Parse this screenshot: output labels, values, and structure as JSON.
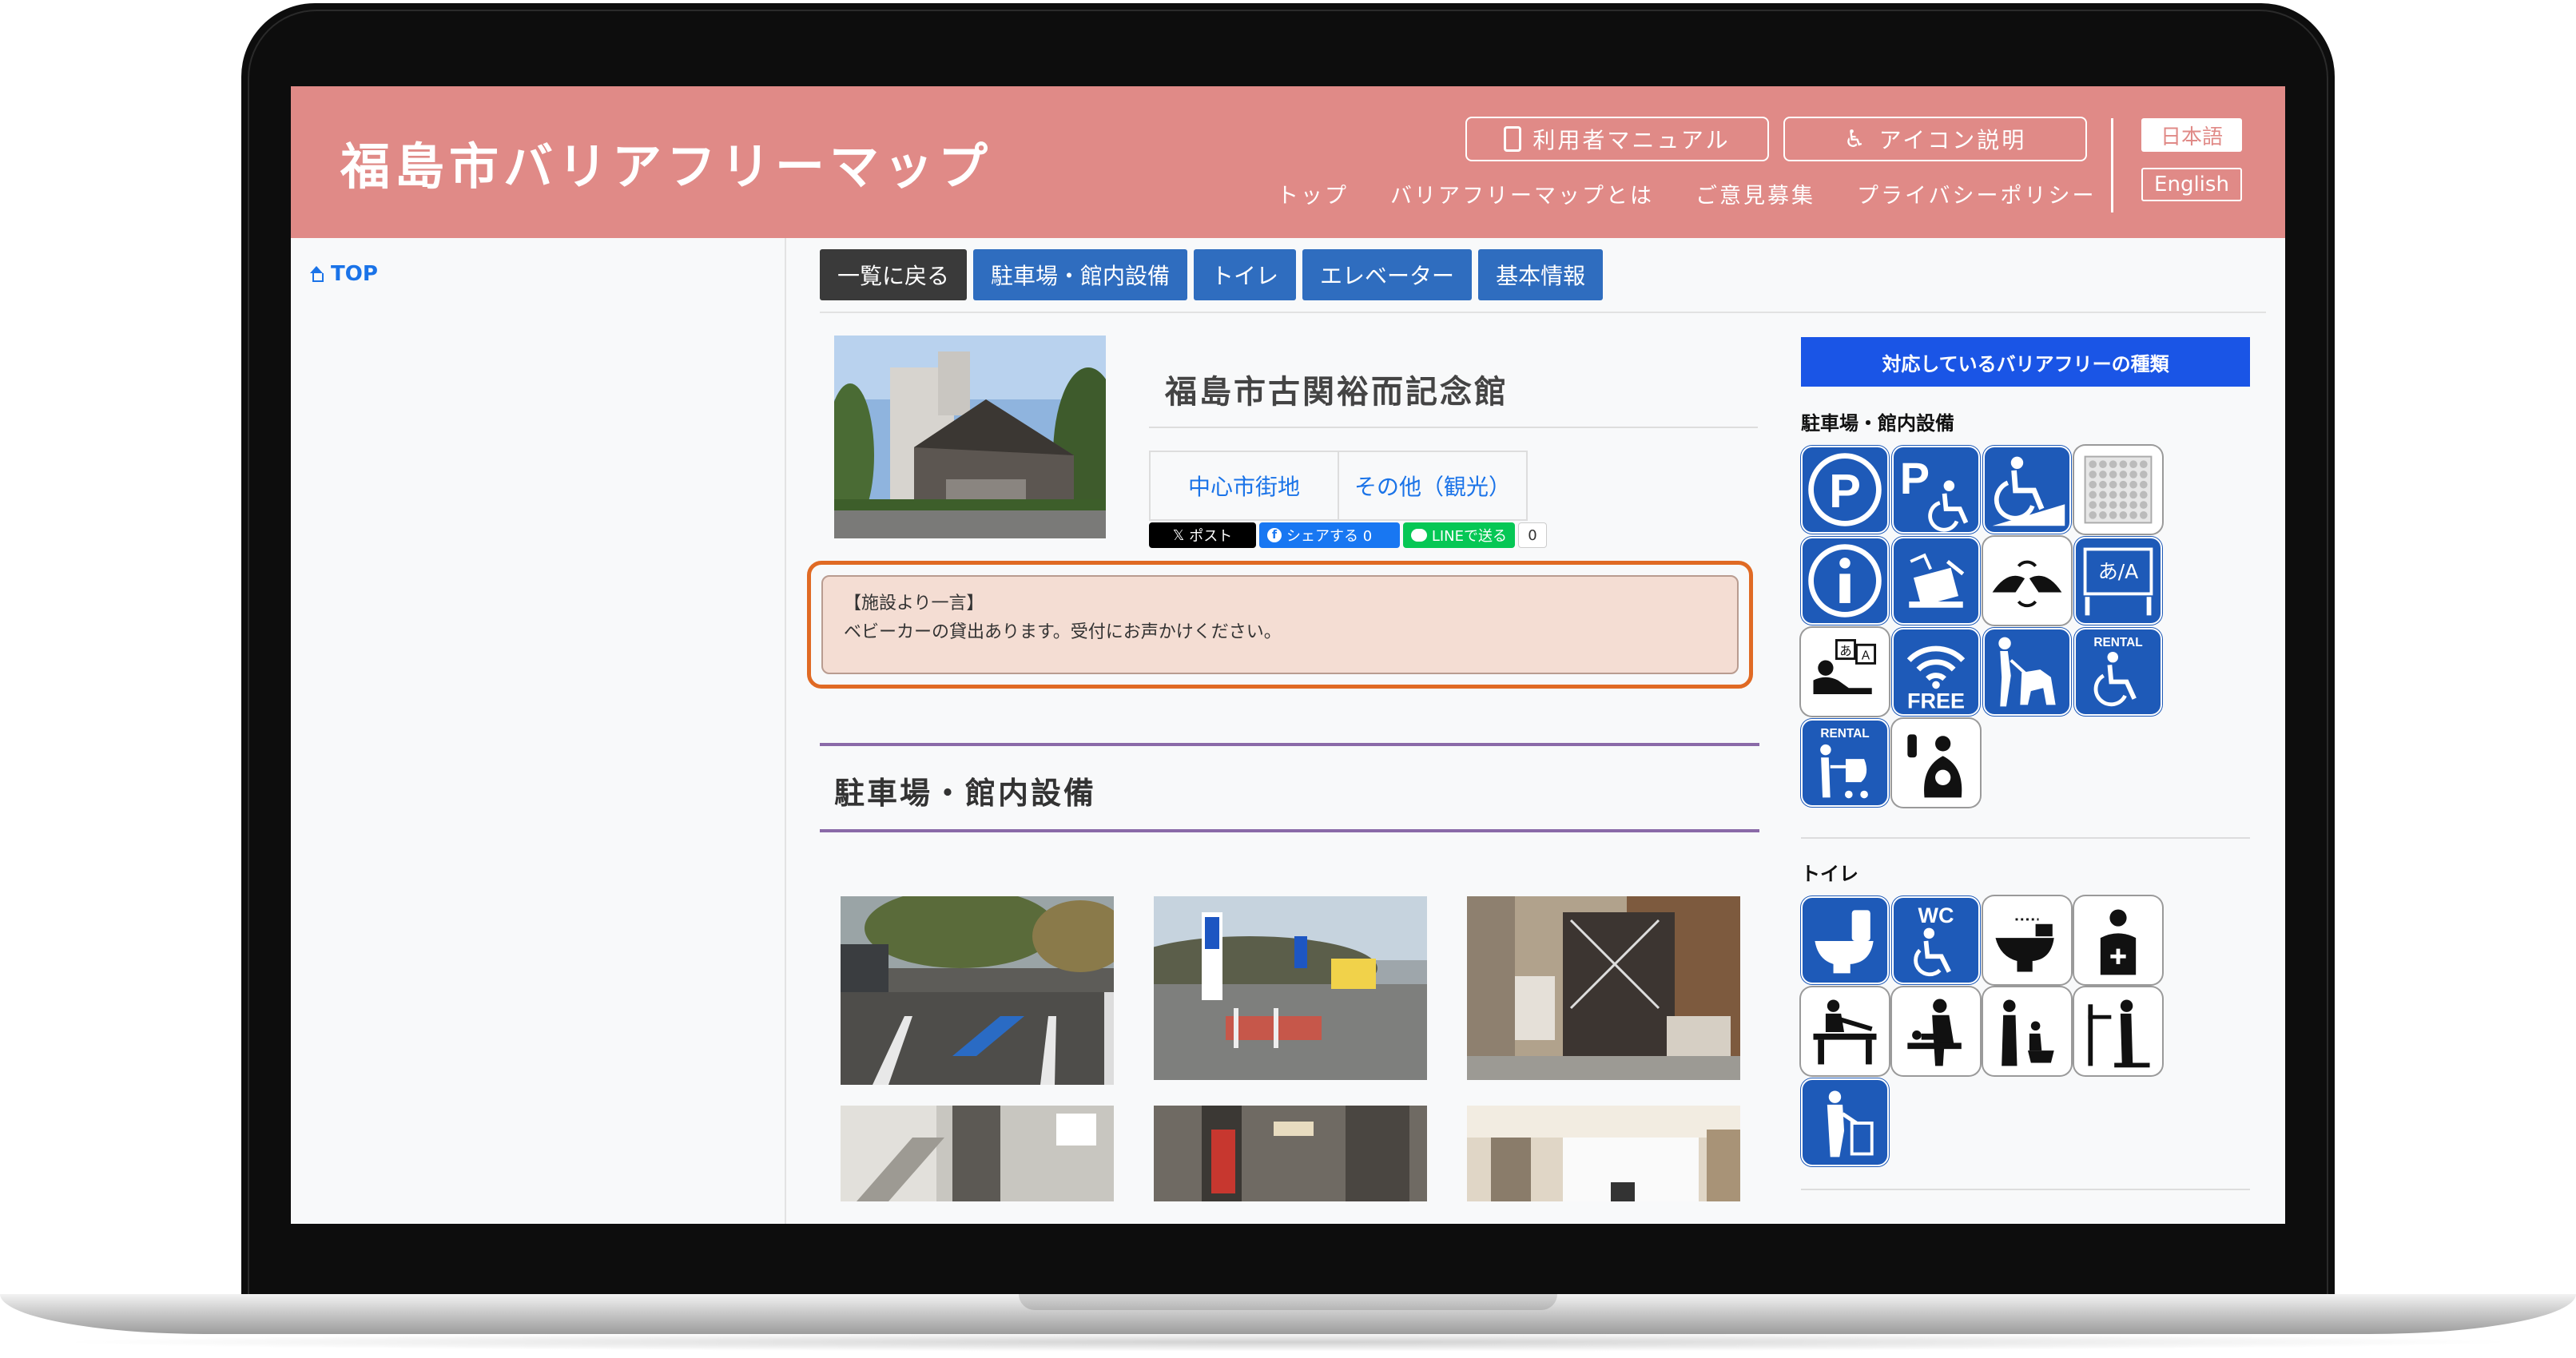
{
  "header": {
    "logo": "福島市バリアフリーマップ",
    "manual_button": "利用者マニュアル",
    "icon_button": "アイコン説明",
    "nav": [
      "トップ",
      "バリアフリーマップとは",
      "ご意見募集",
      "プライバシーポリシー"
    ],
    "lang_ja": "日本語",
    "lang_en": "English"
  },
  "sidebar": {
    "top_link": "TOP"
  },
  "tabs": [
    "一覧に戻る",
    "駐車場・館内設備",
    "トイレ",
    "エレベーター",
    "基本情報"
  ],
  "facility": {
    "name": "福島市古関裕而記念館",
    "categories": [
      "中心市街地",
      "その他（観光）"
    ],
    "share": {
      "x": "ポスト",
      "facebook": "シェアする 0",
      "line": "LINEで送る",
      "count": "0"
    },
    "notice_heading": "【施設より一言】",
    "notice_body": "ベビーカーの貸出あります。受付にお声かけください。"
  },
  "section": {
    "title": "駐車場・館内設備"
  },
  "right": {
    "header": "対応しているバリアフリーの種類",
    "groups": [
      {
        "title": "駐車場・館内設備",
        "icons": [
          "parking-icon",
          "accessible-parking-icon",
          "wheelchair-ramp-icon",
          "tactile-paving-icon",
          "information-icon",
          "writing-board-icon",
          "sign-language-icon",
          "multilingual-sign-icon",
          "interpreter-icon",
          "free-wifi-icon",
          "guide-dog-icon",
          "wheelchair-rental-icon",
          "stroller-rental-icon",
          "nursing-room-icon"
        ],
        "icon_text": {
          "free": "FREE",
          "rental": "RENTAL",
          "ja_a": "あ/A"
        }
      },
      {
        "title": "トイレ",
        "icons": [
          "western-toilet-icon",
          "accessible-wc-icon",
          "washlet-icon",
          "ostomate-icon",
          "adult-changing-bed-icon",
          "baby-changing-icon",
          "child-toilet-icon",
          "handrail-icon",
          "garbage-disposal-icon"
        ],
        "icon_text": {
          "wc": "WC"
        }
      }
    ]
  },
  "colors": {
    "header_bg": "#e08a87",
    "tab_bg": "#2f6dbf",
    "icon_blue": "#1e5ab8",
    "notice_border": "#e06a24",
    "section_line": "#8a6aa8"
  }
}
